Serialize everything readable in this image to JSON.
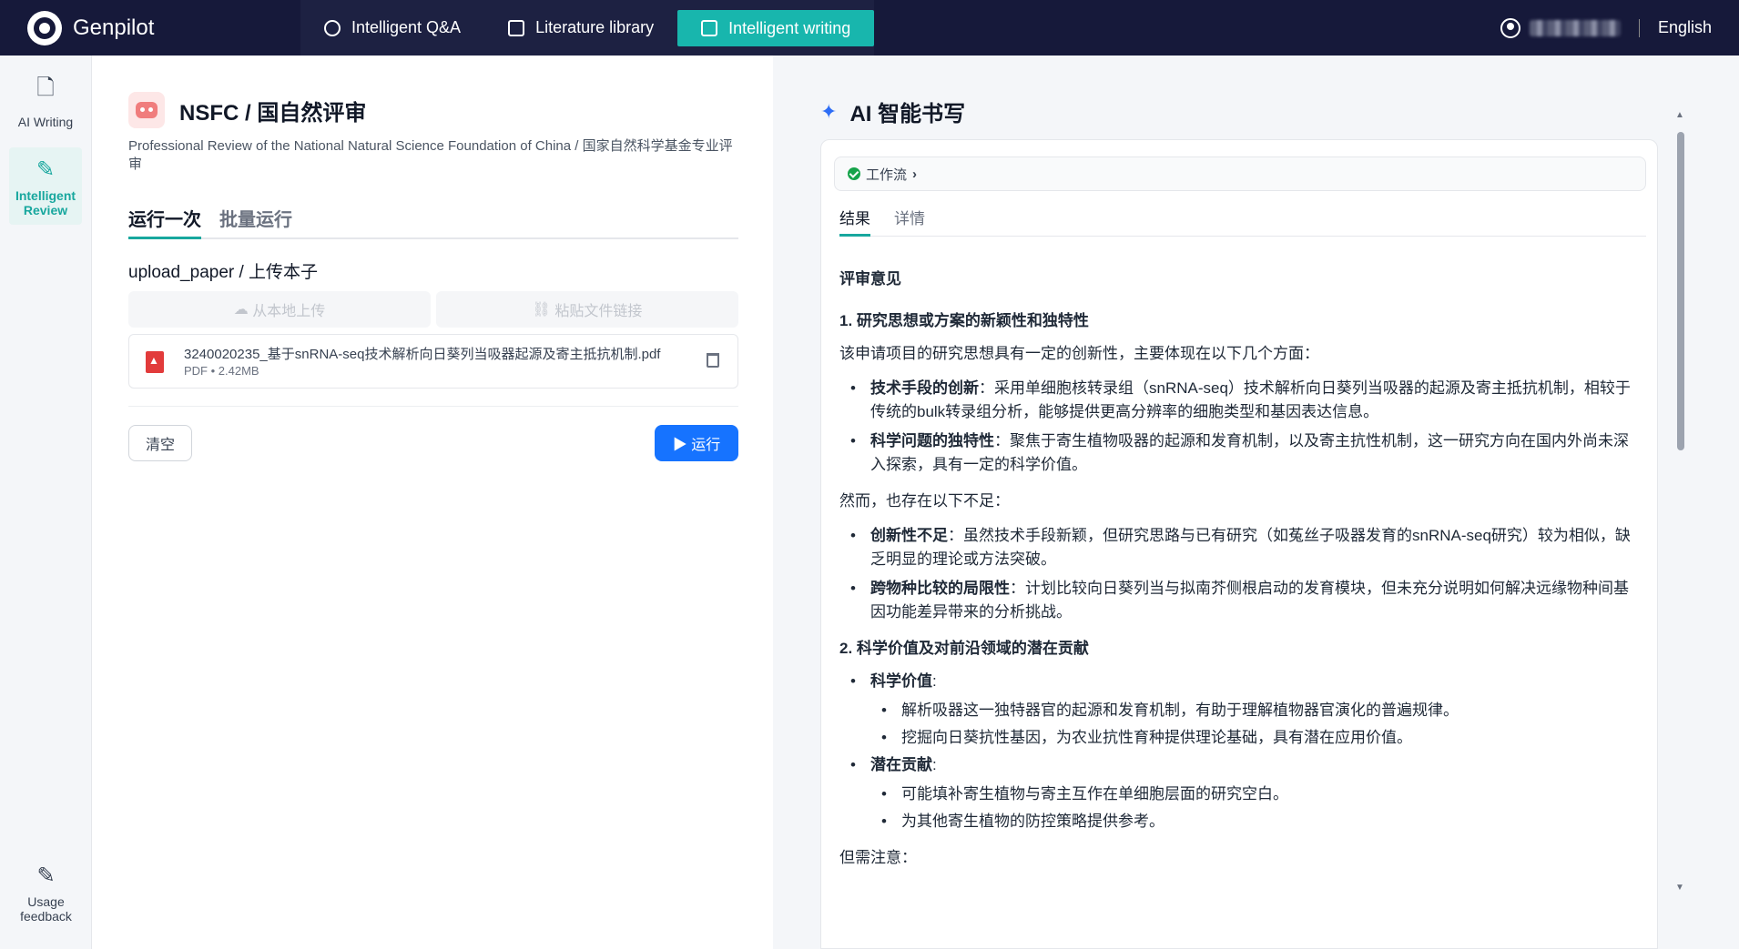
{
  "brand": {
    "name": "Genpilot"
  },
  "nav": [
    {
      "label": "Intelligent Q&A",
      "icon": "gear-icon"
    },
    {
      "label": "Literature library",
      "icon": "book-icon"
    },
    {
      "label": "Intelligent writing",
      "icon": "pen-square-icon",
      "active": true
    }
  ],
  "topright": {
    "language": "English"
  },
  "rail": {
    "items": [
      {
        "label": "AI Writing",
        "icon": "document-edit-icon"
      },
      {
        "label": "Intelligent Review",
        "icon": "review-pen-icon",
        "active": true
      }
    ],
    "bottom": {
      "label": "Usage feedback",
      "icon": "pencil-icon"
    }
  },
  "app": {
    "title": "NSFC / 国自然评审",
    "description": "Professional Review of the National Natural Science Foundation of China / 国家自然科学基金专业评审",
    "tabs": [
      "运行一次",
      "批量运行"
    ],
    "field_label": "upload_paper / 上传本子",
    "upload_local": "从本地上传",
    "paste_link": "粘贴文件链接",
    "file": {
      "name": "3240020235_基于snRNA-seq技术解析向日葵列当吸器起源及寄主抵抗机制.pdf",
      "meta": "PDF • 2.42MB"
    },
    "clear_label": "清空",
    "run_label": "运行"
  },
  "result": {
    "title": "AI 智能书写",
    "workflow_label": "工作流",
    "tabs": [
      "结果",
      "详情"
    ],
    "heading": "评审意见",
    "section1_title": "1. 研究思想或方案的新颖性和独特性",
    "section1_intro": "该申请项目的研究思想具有一定的创新性，主要体现在以下几个方面：",
    "section1_b1_bold": "技术手段的创新",
    "section1_b1_text": "：采用单细胞核转录组（snRNA-seq）技术解析向日葵列当吸器的起源及寄主抵抗机制，相较于传统的bulk转录组分析，能够提供更高分辨率的细胞类型和基因表达信息。",
    "section1_b2_bold": "科学问题的独特性",
    "section1_b2_text": "：聚焦于寄生植物吸器的起源和发育机制，以及寄主抗性机制，这一研究方向在国内外尚未深入探索，具有一定的科学价值。",
    "section1_however": "然而，也存在以下不足：",
    "section1_b3_bold": "创新性不足",
    "section1_b3_text": "：虽然技术手段新颖，但研究思路与已有研究（如菟丝子吸器发育的snRNA-seq研究）较为相似，缺乏明显的理论或方法突破。",
    "section1_b4_bold": "跨物种比较的局限性",
    "section1_b4_text": "：计划比较向日葵列当与拟南芥侧根启动的发育模块，但未充分说明如何解决远缘物种间基因功能差异带来的分析挑战。",
    "section2_title": "2. 科学价值及对前沿领域的潜在贡献",
    "section2_b1_bold": "科学价值",
    "section2_b1_sub1": "解析吸器这一独特器官的起源和发育机制，有助于理解植物器官演化的普遍规律。",
    "section2_b1_sub2": "挖掘向日葵抗性基因，为农业抗性育种提供理论基础，具有潜在应用价值。",
    "section2_b2_bold": "潜在贡献",
    "section2_b2_sub1": "可能填补寄生植物与寄主互作在单细胞层面的研究空白。",
    "section2_b2_sub2": "为其他寄生植物的防控策略提供参考。",
    "section2_note": "但需注意："
  },
  "colors": {
    "topbar": "#16193a",
    "accent": "#18b6ad",
    "primary_button": "#1673ff"
  }
}
